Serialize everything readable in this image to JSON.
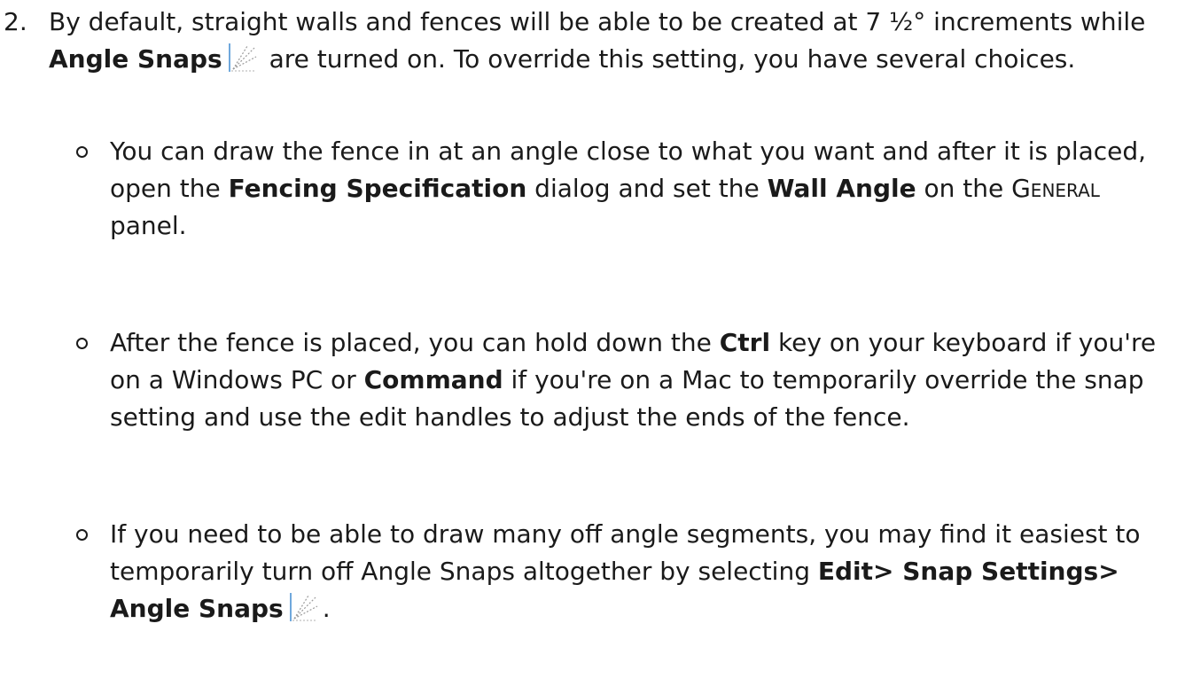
{
  "step": {
    "number": "2.",
    "text_1": "By default, straight walls and fences will be able to be created at 7 ½° increments while ",
    "bold_angle_snaps": "Angle Snaps",
    "text_2": " are turned on. To override this setting, you have several choices."
  },
  "bullets": [
    {
      "text_1": "You can draw the fence in at an angle close to what you want and after it is placed, open the ",
      "bold_1": "Fencing Specification",
      "text_2": " dialog and set the ",
      "bold_2": "Wall Angle",
      "text_3": " on the ",
      "smallcaps_1": "General",
      "text_4": " panel."
    },
    {
      "text_1": "After the fence is placed, you can hold down the ",
      "bold_1": "Ctrl",
      "text_2": " key on your keyboard if you're on a Windows PC or ",
      "bold_2": "Command",
      "text_3": " if you're on a Mac to temporarily override the snap setting and use the edit handles to adjust the ends of the fence."
    },
    {
      "text_1": "If you need to be able to draw many off angle segments, you may find it easiest to temporarily turn off Angle Snaps altogether by selecting ",
      "bold_1": "Edit> Snap Settings> Angle Snaps",
      "text_2": "."
    }
  ],
  "icons": {
    "angle_snaps": "angle-snaps-icon"
  },
  "colors": {
    "text": "#1a1a1a",
    "icon_accent": "#6fa8dc"
  }
}
